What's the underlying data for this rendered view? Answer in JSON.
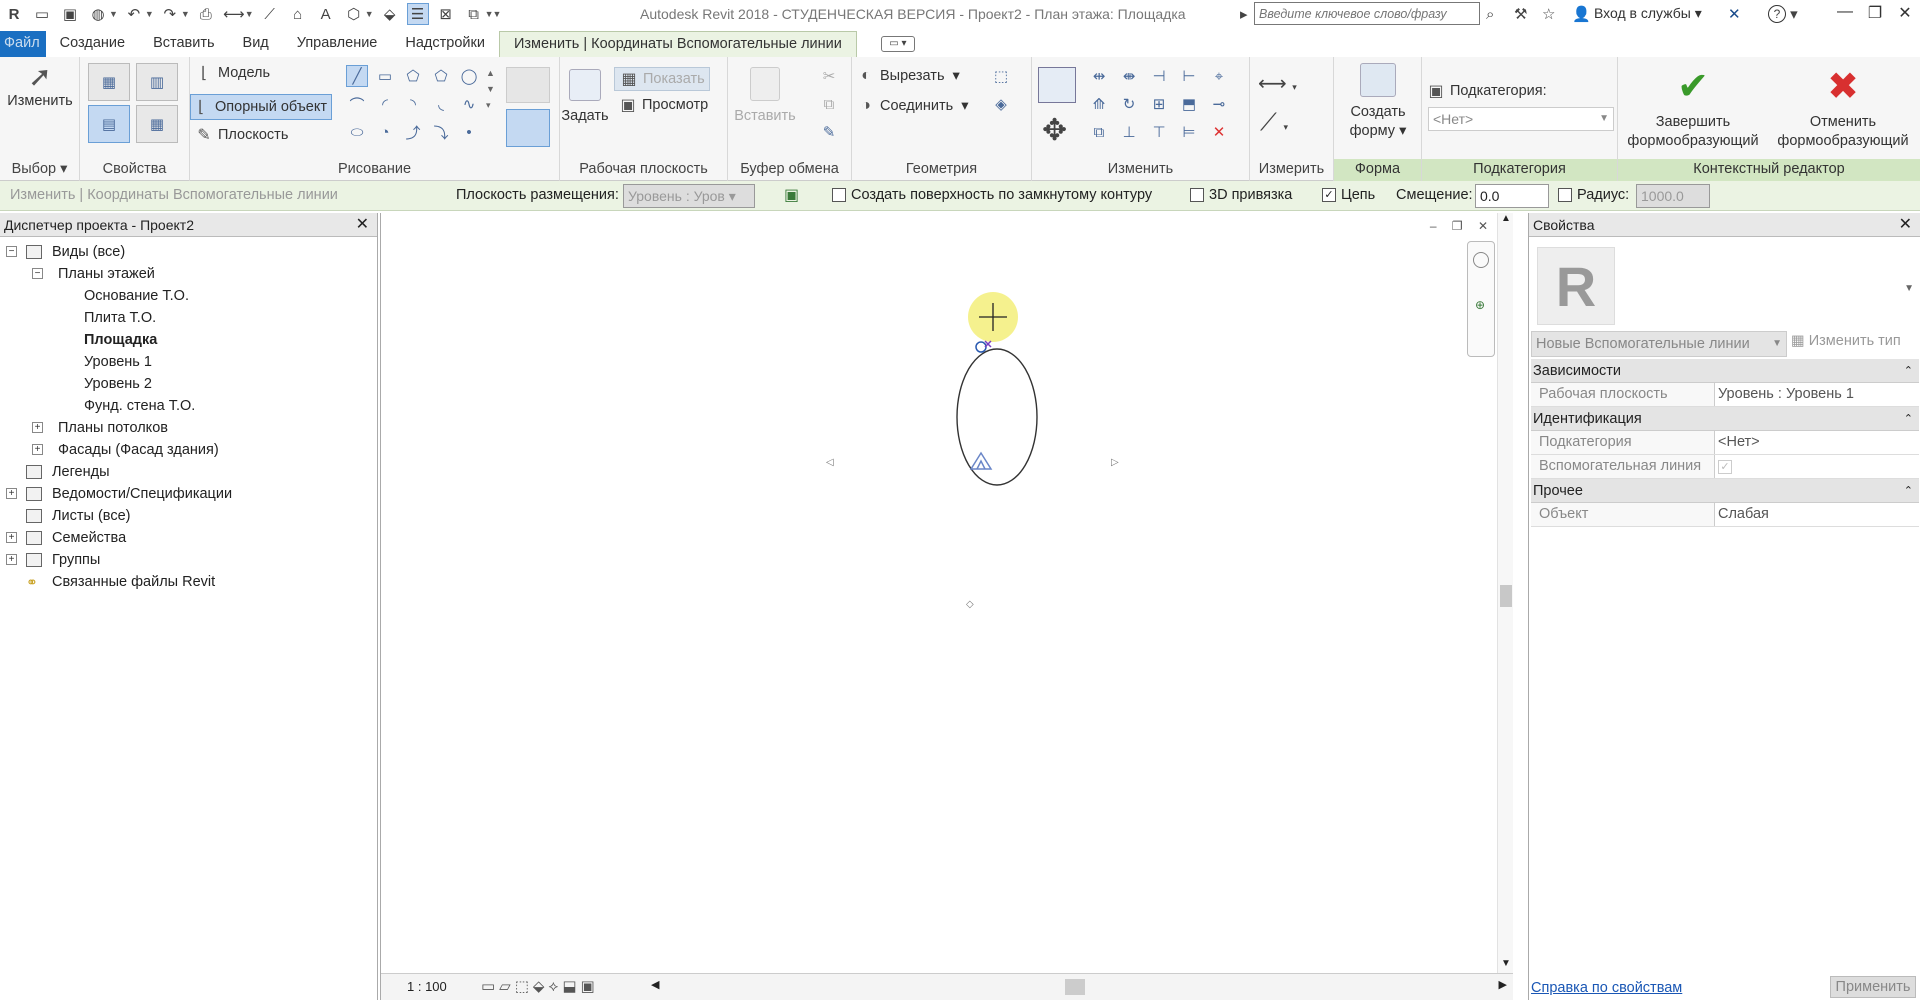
{
  "app": {
    "title": "Autodesk Revit 2018 - СТУДЕНЧЕСКАЯ ВЕРСИЯ -     Проект2 - План этажа: Площадка",
    "search_placeholder": "Введите ключевое слово/фразу",
    "login_label": "Вход в службы",
    "help_label": "?"
  },
  "tabs": {
    "file": "Файл",
    "items": [
      "Создание",
      "Вставить",
      "Вид",
      "Управление",
      "Надстройки"
    ],
    "active": "Изменить | Координаты Вспомогательные линии"
  },
  "ribbon": {
    "select": {
      "modify": "Изменить",
      "title": "Выбор"
    },
    "properties": {
      "title": "Свойства"
    },
    "draw": {
      "model": "Модель",
      "ref": "Опорный объект",
      "plane": "Плоскость",
      "title": "Рисование"
    },
    "workplane": {
      "set": "Задать",
      "show": "Показать",
      "viewer": "Просмотр",
      "title": "Рабочая плоскость"
    },
    "clipboard": {
      "paste": "Вставить",
      "title": "Буфер обмена"
    },
    "geometry": {
      "cut": "Вырезать",
      "join": "Соединить",
      "title": "Геометрия"
    },
    "modify": {
      "title": "Изменить"
    },
    "measure": {
      "title": "Измерить"
    },
    "form": {
      "create_l1": "Создать",
      "create_l2": "форму",
      "title": "Форма"
    },
    "subcategory": {
      "label": "Подкатегория:",
      "value": "<Нет>",
      "title": "Подкатегория"
    },
    "ctx": {
      "finish_l1": "Завершить",
      "finish_l2": "формообразующий",
      "cancel_l1": "Отменить",
      "cancel_l2": "формообразующий",
      "title": "Контекстный редактор"
    }
  },
  "options": {
    "context": "Изменить | Координаты Вспомогательные линии",
    "placement_label": "Плоскость размещения:",
    "placement_value": "Уровень : Уров",
    "closed_surface": "Создать поверхность по замкнутому контуру",
    "snap3d": "3D привязка",
    "chain": "Цепь",
    "offset_label": "Смещение:",
    "offset_value": "0.0",
    "radius_label": "Радиус:",
    "radius_value": "1000.0"
  },
  "browser": {
    "title": "Диспетчер проекта - Проект2",
    "views": "Виды (все)",
    "floor_plans": "Планы этажей",
    "plans": [
      "Основание Т.О.",
      "Плита Т.О.",
      "Площадка",
      "Уровень 1",
      "Уровень 2",
      "Фунд. стена Т.О."
    ],
    "ceilings": "Планы потолков",
    "facades": "Фасады (Фасад здания)",
    "legends": "Легенды",
    "schedules": "Ведомости/Спецификации",
    "sheets": "Листы (все)",
    "families": "Семейства",
    "groups": "Группы",
    "links": "Связанные файлы Revit"
  },
  "view": {
    "scale": "1 : 100"
  },
  "properties": {
    "title": "Свойства",
    "type_name": "Новые Вспомогательные линии",
    "edit_type": "Изменить тип",
    "sections": [
      {
        "name": "Зависимости",
        "rows": [
          {
            "k": "Рабочая плоскость",
            "v": "Уровень : Уровень 1"
          }
        ]
      },
      {
        "name": "Идентификация",
        "rows": [
          {
            "k": "Подкатегория",
            "v": "<Нет>"
          },
          {
            "k": "Вспомогательная линия",
            "v": ""
          }
        ]
      },
      {
        "name": "Прочее",
        "rows": [
          {
            "k": "Объект",
            "v": "Слабая"
          }
        ]
      }
    ],
    "help_link": "Справка по свойствам",
    "apply": "Применить"
  }
}
